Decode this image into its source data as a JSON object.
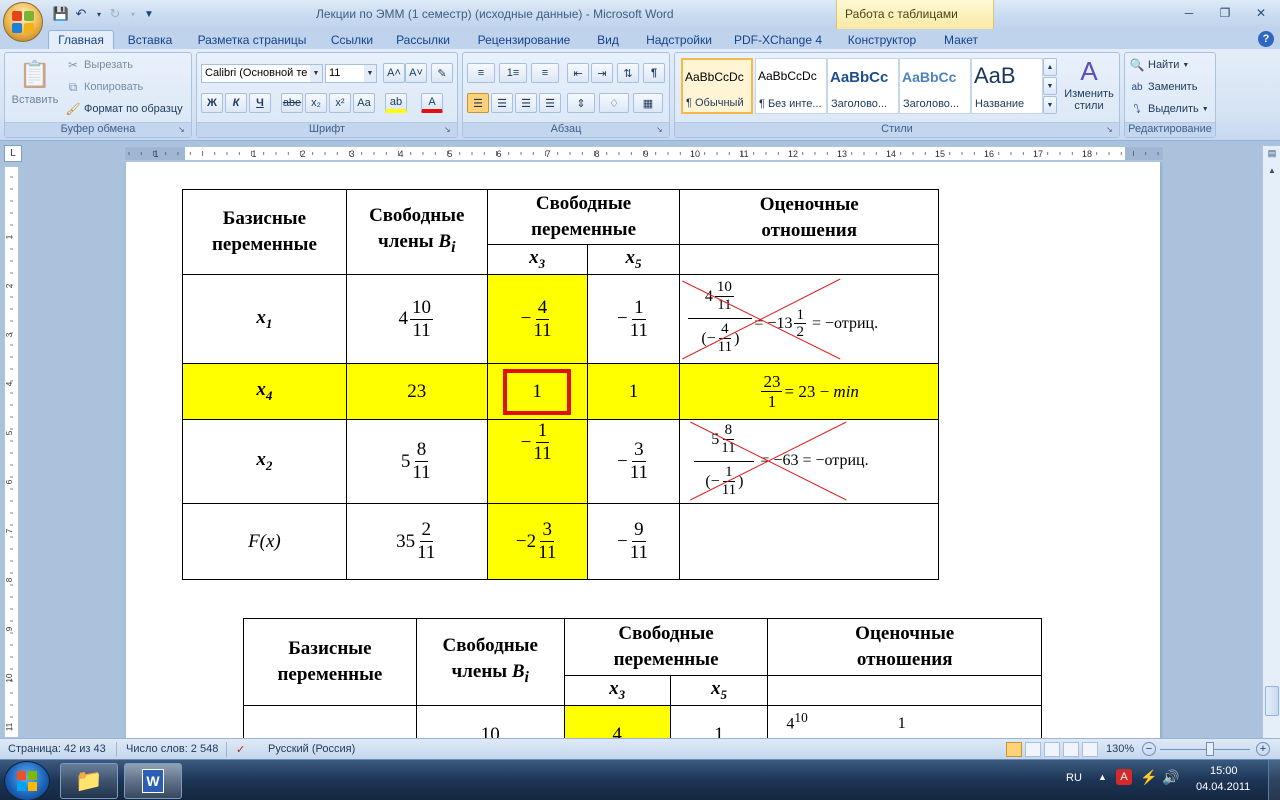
{
  "window": {
    "title": "Лекции по ЭММ (1 семестр) (исходные данные) - Microsoft Word",
    "context_tab_title": "Работа с таблицами"
  },
  "ribbon_tabs": [
    "Главная",
    "Вставка",
    "Разметка страницы",
    "Ссылки",
    "Рассылки",
    "Рецензирование",
    "Вид",
    "Надстройки",
    "PDF-XChange 4",
    "Конструктор",
    "Макет"
  ],
  "clipboard": {
    "paste": "Вставить",
    "cut": "Вырезать",
    "copy": "Копировать",
    "format_painter": "Формат по образцу",
    "label": "Буфер обмена"
  },
  "font": {
    "name": "Calibri (Основной те",
    "size": "11",
    "label": "Шрифт",
    "bold": "Ж",
    "italic": "К",
    "underline": "Ч",
    "strike": "abe",
    "subscript": "x₂",
    "superscript": "x²",
    "change_case": "Aa",
    "grow": "A˄",
    "shrink": "A˅"
  },
  "paragraph": {
    "label": "Абзац"
  },
  "styles": {
    "items": [
      {
        "preview": "AaBbCcDc",
        "name": "¶ Обычный"
      },
      {
        "preview": "AaBbCcDc",
        "name": "¶ Без инте..."
      },
      {
        "preview": "AaBbCc",
        "name": "Заголово..."
      },
      {
        "preview": "AaBbCc",
        "name": "Заголово..."
      },
      {
        "preview": "AaB",
        "name": "Название"
      }
    ],
    "change_styles": "Изменить стили",
    "label": "Стили"
  },
  "editing": {
    "find": "Найти",
    "replace": "Заменить",
    "select": "Выделить",
    "label": "Редактирование"
  },
  "ruler": {
    "h_numbers": [
      "2",
      "1",
      "1",
      "2",
      "3",
      "4",
      "5",
      "6",
      "7",
      "8",
      "9",
      "10",
      "11",
      "12",
      "13",
      "14",
      "15",
      "16",
      "17",
      "18"
    ],
    "v_numbers": [
      "1",
      "2",
      "3",
      "4",
      "5",
      "6",
      "7",
      "8",
      "9",
      "10",
      "11"
    ],
    "tab_selector": "L"
  },
  "table1": {
    "headers": {
      "basis": [
        "Базисные",
        "переменные"
      ],
      "free": [
        "Свободные",
        "члены"
      ],
      "free_sym": "B",
      "free_sub": "i",
      "freevars": [
        "Свободные",
        "переменные"
      ],
      "ratios": [
        "Оценочные",
        "отношения"
      ],
      "x3": "x",
      "x3_sub": "3",
      "x5": "x",
      "x5_sub": "5"
    },
    "rows": [
      {
        "var": "x",
        "var_sub": "1",
        "b_int": "4",
        "b_num": "10",
        "b_den": "11",
        "x3_sign": "−",
        "x3_num": "4",
        "x3_den": "11",
        "x5_sign": "−",
        "x5_num": "1",
        "x5_den": "11",
        "ratio_top_int": "4",
        "ratio_top_num": "10",
        "ratio_top_den": "11",
        "ratio_bot_open": "(−",
        "ratio_bot_num": "4",
        "ratio_bot_den": "11",
        "ratio_bot_close": ")",
        "ratio_rest": "= −13",
        "ratio_half_num": "1",
        "ratio_half_den": "2",
        "ratio_tail": "=  −отриц."
      },
      {
        "var": "x",
        "var_sub": "4",
        "b": "23",
        "pivot": "1",
        "x5": "1",
        "ratio_num": "23",
        "ratio_den": "1",
        "ratio_rest": "= 23 − ",
        "ratio_min": "min"
      },
      {
        "var": "x",
        "var_sub": "2",
        "b_int": "5",
        "b_num": "8",
        "b_den": "11",
        "x3_sign": "−",
        "x3_num": "1",
        "x3_den": "11",
        "x5_sign": "−",
        "x5_num": "3",
        "x5_den": "11",
        "ratio_top_int": "5",
        "ratio_top_num": "8",
        "ratio_top_den": "11",
        "ratio_bot_open": "(−",
        "ratio_bot_num": "1",
        "ratio_bot_den": "11",
        "ratio_bot_close": ")",
        "ratio_tail": "= −63 =  −отриц."
      },
      {
        "var": "F(x)",
        "b_int": "35",
        "b_num": "2",
        "b_den": "11",
        "x3_int": "−2",
        "x3_num": "3",
        "x3_den": "11",
        "x5_sign": "−",
        "x5_num": "9",
        "x5_den": "11"
      }
    ]
  },
  "table2": {
    "headers": {
      "basis": [
        "Базисные",
        "переменные"
      ],
      "free": [
        "Свободные",
        "члены"
      ],
      "free_sym": "B",
      "free_sub": "i",
      "freevars": [
        "Свободные",
        "переменные"
      ],
      "ratios": [
        "Оценочные",
        "отношения"
      ],
      "x3": "x",
      "x3_sub": "3",
      "x5": "x",
      "x5_sub": "5"
    },
    "partial_row": {
      "b_num": "10",
      "x3_num": "4",
      "x5_num": "1",
      "ratio_int": "4",
      "ratio_num": "10",
      "ratio_tail": "1"
    }
  },
  "statusbar": {
    "page": "Страница: 42 из 43",
    "words": "Число слов: 2 548",
    "language": "Русский (Россия)",
    "zoom": "130%"
  },
  "taskbar": {
    "lang": "RU",
    "time": "15:00",
    "date": "04.04.2011"
  }
}
